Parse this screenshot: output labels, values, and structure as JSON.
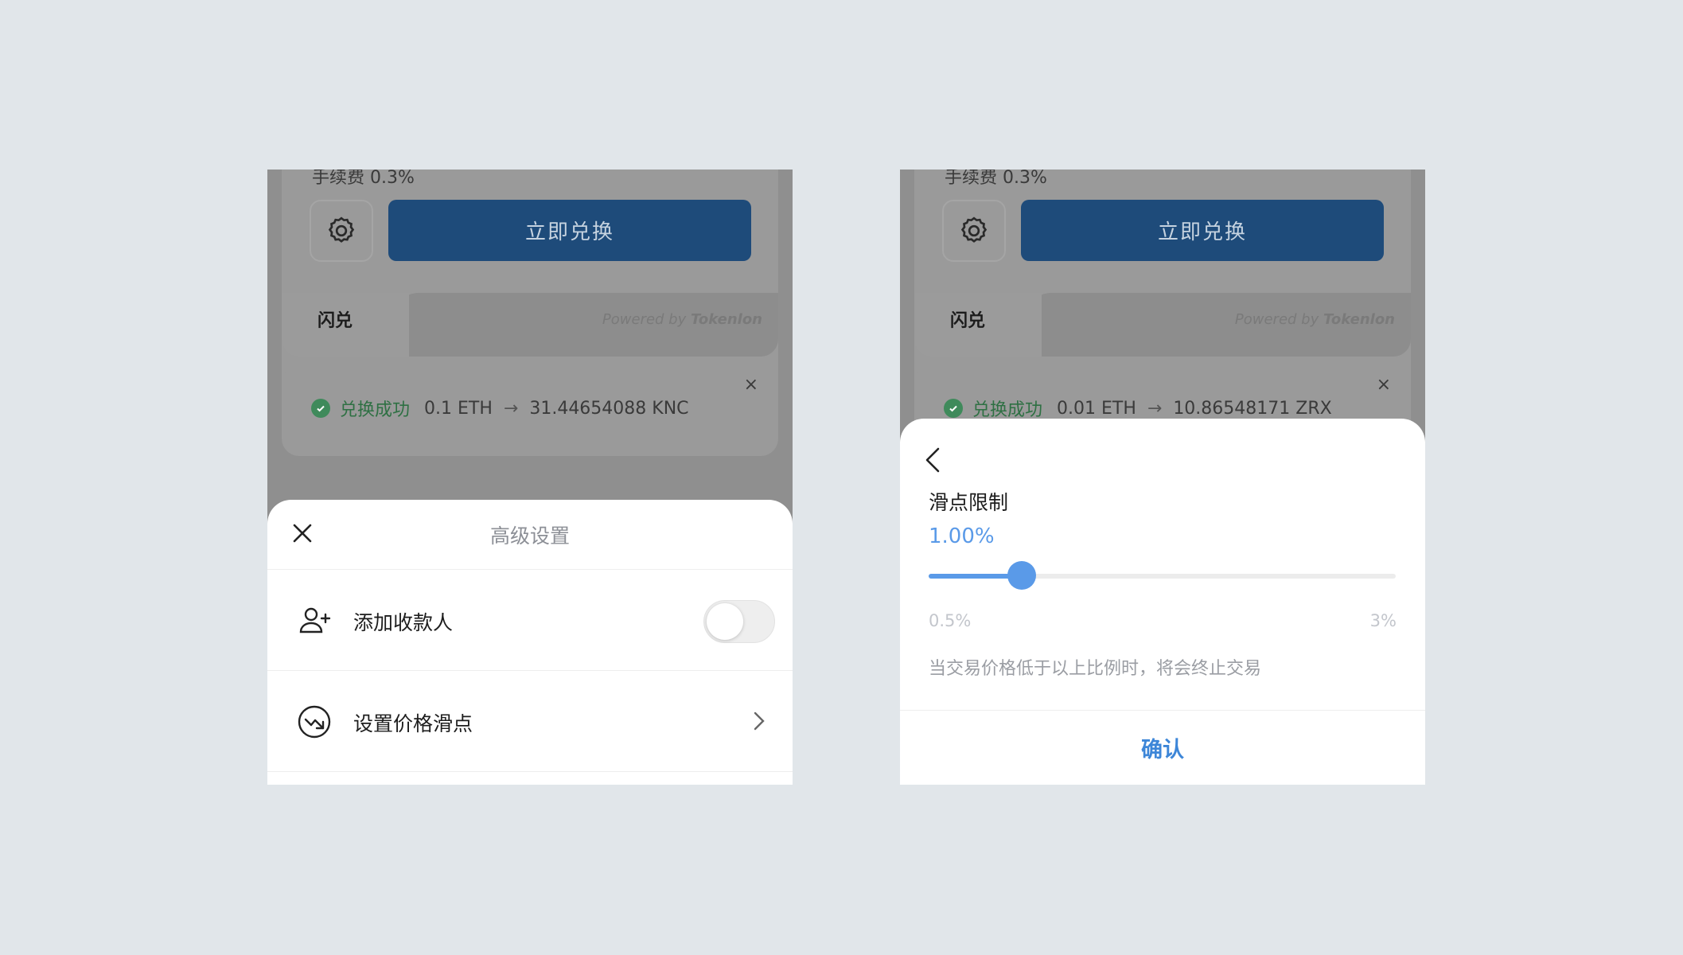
{
  "left": {
    "fee_partial": "手续费 0.3%",
    "swap_button": "立即兑换",
    "tab_flash": "闪兑",
    "powered_prefix": "Powered by ",
    "powered_brand": "Tokenlon",
    "notice": {
      "status": "兑换成功",
      "from": "0.1 ETH",
      "to": "31.44654088 KNC",
      "close": "×"
    },
    "sheet": {
      "title": "高级设置",
      "rows": [
        {
          "label": "添加收款人",
          "icon": "add-user-icon",
          "control": "toggle",
          "toggle_on": false
        },
        {
          "label": "设置价格滑点",
          "icon": "price-trend-icon",
          "control": "chevron"
        }
      ]
    }
  },
  "right": {
    "fee_partial": "手续费 0.3%",
    "swap_button": "立即兑换",
    "tab_flash": "闪兑",
    "powered_prefix": "Powered by ",
    "powered_brand": "Tokenlon",
    "notice": {
      "status": "兑换成功",
      "from": "0.01 ETH",
      "to": "10.86548171 ZRX",
      "close": "×"
    },
    "sheet": {
      "title": "滑点限制",
      "value": "1.00%",
      "slider_fraction": 0.2,
      "range_min": "0.5%",
      "range_max": "3%",
      "hint": "当交易价格低于以上比例时，将会终止交易",
      "confirm": "确认"
    }
  },
  "colors": {
    "background": "#e1e6ea",
    "primary_button": "#1e4b7a",
    "accent_blue": "#5a9ae8",
    "success_green": "#3f8a5b"
  }
}
